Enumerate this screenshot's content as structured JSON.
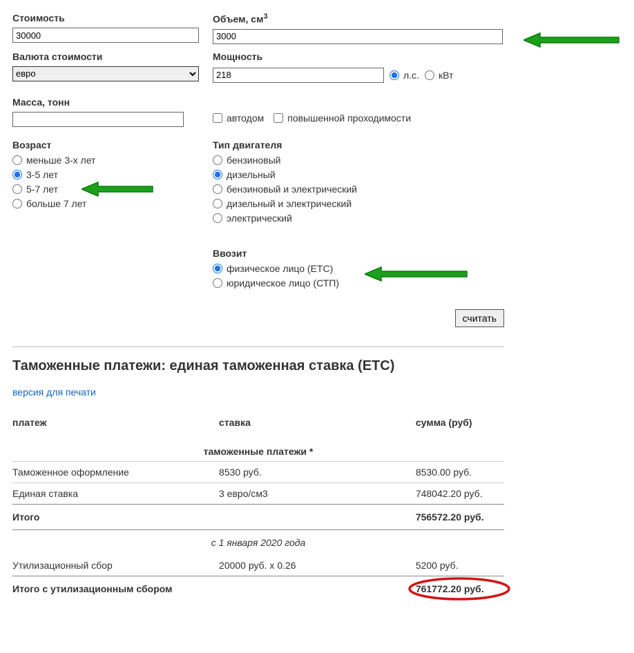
{
  "form": {
    "cost": {
      "label": "Стоимость",
      "value": "30000"
    },
    "volume": {
      "label": "Объем, см",
      "sup": "3",
      "value": "3000"
    },
    "currency": {
      "label": "Валюта стоимости",
      "value": "евро"
    },
    "power": {
      "label": "Мощность",
      "value": "218",
      "unit_hp": "л.с.",
      "unit_kw": "кВт"
    },
    "mass": {
      "label": "Масса, тонн",
      "value": ""
    },
    "motorhome": "автодом",
    "offroad": "повышенной проходимости",
    "age": {
      "label": "Возраст",
      "options": [
        "меньше 3-х лет",
        "3-5 лет",
        "5-7 лет",
        "больше 7 лет"
      ],
      "selected": 1
    },
    "engine": {
      "label": "Тип двигателя",
      "options": [
        "бензиновый",
        "дизельный",
        "бензиновый и электрический",
        "дизельный и электрический",
        "электрический"
      ],
      "selected": 1
    },
    "importer": {
      "label": "Ввозит",
      "options": [
        "физическое лицо (ЕТС)",
        "юридическое лицо (СТП)"
      ],
      "selected": 0
    },
    "calculate_btn": "считать"
  },
  "results": {
    "title": "Таможенные платежи: единая таможенная ставка (ЕТС)",
    "print_link": "версия для печати",
    "headers": {
      "payment": "платеж",
      "rate": "ставка",
      "sum": "сумма (руб)"
    },
    "section1_title": "таможенные платежи *",
    "rows": [
      {
        "payment": "Таможенное оформление",
        "rate": "8530 руб.",
        "sum": "8530.00 руб."
      },
      {
        "payment": "Единая ставка",
        "rate": "3 евро/см3",
        "sum": "748042.20 руб."
      }
    ],
    "subtotal": {
      "label": "Итого",
      "sum": "756572.20 руб."
    },
    "from_date": "с 1 января 2020 года",
    "util_fee": {
      "payment": "Утилизационный сбор",
      "rate": "20000 руб. x 0.26",
      "sum": "5200 руб."
    },
    "grand_total": {
      "label": "Итого с утилизационным сбором",
      "sum": "761772.20 руб."
    }
  }
}
